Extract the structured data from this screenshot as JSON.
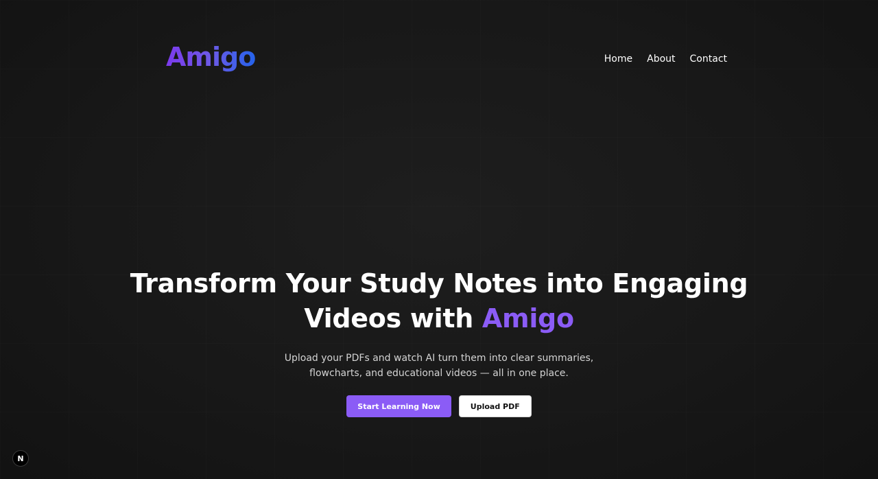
{
  "header": {
    "logo_text": "Amigo",
    "nav": [
      {
        "label": "Home"
      },
      {
        "label": "About"
      },
      {
        "label": "Contact"
      }
    ]
  },
  "hero": {
    "title_line1": "Transform Your Study Notes into Engaging",
    "title_line2_prefix": "Videos with ",
    "title_brand": "Amigo",
    "subtitle": "Upload your PDFs and watch AI turn them into clear summaries, flowcharts, and educational videos — all in one place.",
    "primary_button": "Start Learning Now",
    "secondary_button": "Upload PDF"
  },
  "dev_badge": {
    "label": "N",
    "icon": "nextjs-icon"
  },
  "colors": {
    "accent": "#8b5cf6",
    "logo_gradient_start": "#7c3aed",
    "logo_gradient_end": "#2563eb",
    "background": "#1a1a1a"
  }
}
